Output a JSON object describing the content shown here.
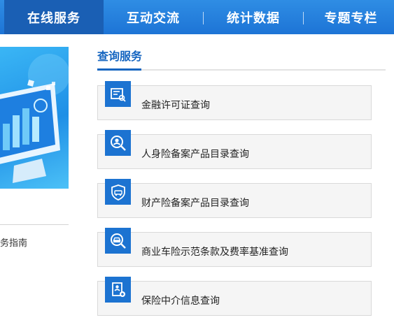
{
  "nav": {
    "items": [
      {
        "label": "在线服务",
        "active": true
      },
      {
        "label": "互动交流",
        "active": false
      },
      {
        "label": "统计数据",
        "active": false
      },
      {
        "label": "专题专栏",
        "active": false
      }
    ]
  },
  "left": {
    "link_text": "务指南"
  },
  "section": {
    "title": "查询服务"
  },
  "cards": [
    {
      "label": "金融许可证查询",
      "icon": "license-document-icon"
    },
    {
      "label": "人身险备案产品目录查询",
      "icon": "person-search-icon"
    },
    {
      "label": "财产险备案产品目录查询",
      "icon": "shield-car-icon"
    },
    {
      "label": "商业车险示范条款及费率基准查询",
      "icon": "car-search-icon"
    },
    {
      "label": "保险中介信息查询",
      "icon": "person-document-icon"
    }
  ],
  "colors": {
    "nav_bg": "#1d74d6",
    "nav_active": "#1a5fb4",
    "accent": "#1565c0",
    "icon_bg": "#1c73d1",
    "card_bg": "#f5f5f5"
  }
}
